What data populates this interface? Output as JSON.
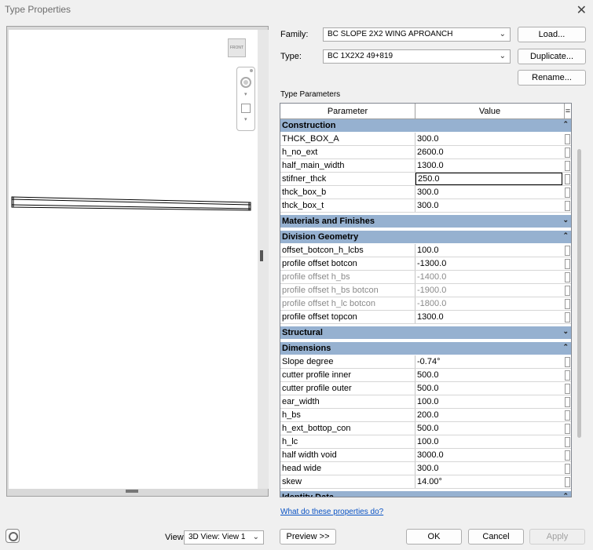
{
  "window": {
    "title": "Type Properties",
    "close_glyph": "✕"
  },
  "preview": {
    "viewcube_label": "FRONT"
  },
  "family": {
    "label": "Family:",
    "value": "BC SLOPE 2X2 WING APROANCH"
  },
  "type": {
    "label": "Type:",
    "value": "BC 1X2X2 49+819"
  },
  "buttons": {
    "load": "Load...",
    "duplicate": "Duplicate...",
    "rename": "Rename...",
    "preview": "Preview >>",
    "ok": "OK",
    "cancel": "Cancel",
    "apply": "Apply"
  },
  "type_parameters_label": "Type Parameters",
  "grid": {
    "col_parameter": "Parameter",
    "col_value": "Value",
    "col_eq": "=",
    "groups": [
      {
        "name": "Construction",
        "expanded": true,
        "rows": [
          {
            "param": "THCK_BOX_A",
            "value": "300.0"
          },
          {
            "param": "h_no_ext",
            "value": "2600.0"
          },
          {
            "param": "half_main_width",
            "value": "1300.0"
          },
          {
            "param": "stifner_thck",
            "value": "250.0"
          },
          {
            "param": "thck_box_b",
            "value": "300.0"
          },
          {
            "param": "thck_box_t",
            "value": "300.0"
          }
        ]
      },
      {
        "name": "Materials and Finishes",
        "expanded": false,
        "rows": []
      },
      {
        "name": "Division Geometry",
        "expanded": true,
        "rows": [
          {
            "param": "offset_botcon_h_lcbs",
            "value": "100.0"
          },
          {
            "param": "profile offset botcon",
            "value": "-1300.0"
          },
          {
            "param": "profile offset h_bs",
            "value": "-1400.0"
          },
          {
            "param": "profile offset h_bs botcon",
            "value": "-1900.0"
          },
          {
            "param": "profile offset h_lc botcon",
            "value": "-1800.0"
          },
          {
            "param": "profile offset topcon",
            "value": "1300.0"
          }
        ]
      },
      {
        "name": "Structural",
        "expanded": false,
        "rows": []
      },
      {
        "name": "Dimensions",
        "expanded": true,
        "rows": [
          {
            "param": "Slope degree",
            "value": "-0.74°"
          },
          {
            "param": "cutter profile inner",
            "value": "500.0"
          },
          {
            "param": "cutter profile outer",
            "value": "500.0"
          },
          {
            "param": "ear_width",
            "value": "100.0"
          },
          {
            "param": "h_bs",
            "value": "200.0"
          },
          {
            "param": "h_ext_bottop_con",
            "value": "500.0"
          },
          {
            "param": "h_lc",
            "value": "100.0"
          },
          {
            "param": "half width void",
            "value": "3000.0"
          },
          {
            "param": "head wide",
            "value": "300.0"
          },
          {
            "param": "skew",
            "value": "14.00°"
          }
        ]
      },
      {
        "name": "Identity Data",
        "expanded": true,
        "rows": []
      }
    ]
  },
  "help_link": "What do these properties do?",
  "view": {
    "label": "View:",
    "value": "3D View: View 1"
  }
}
